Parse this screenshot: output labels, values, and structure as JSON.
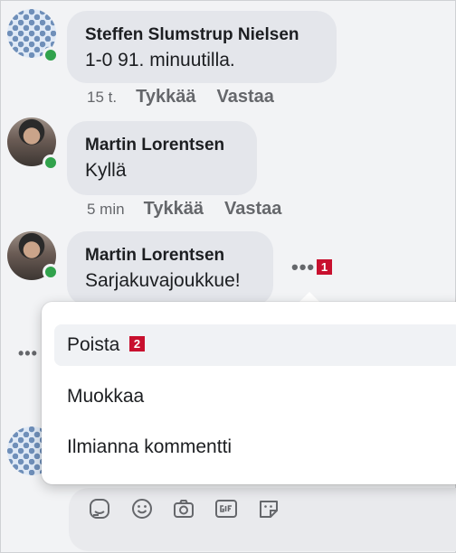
{
  "comments": [
    {
      "author": "Steffen Slumstrup Nielsen",
      "text": "1-0 91. minuutilla.",
      "time": "15 t.",
      "like": "Tykkää",
      "reply": "Vastaa",
      "avatar": "pattern-avatar"
    },
    {
      "author": "Martin Lorentsen",
      "text": "Kyllä",
      "time": "5 min",
      "like": "Tykkää",
      "reply": "Vastaa",
      "avatar": "photo-avatar"
    },
    {
      "author": "Martin Lorentsen",
      "text": "Sarjakuvajoukkue!",
      "avatar": "photo-avatar"
    }
  ],
  "more_dots": "•••",
  "badges": {
    "one": "1",
    "two": "2"
  },
  "menu": {
    "items": [
      "Poista",
      "Muokkaa",
      "Ilmianna kommentti"
    ]
  },
  "composer_icons": [
    "sticker-icon",
    "emoji-icon",
    "camera-icon",
    "gif-icon",
    "sticker-face-icon"
  ],
  "colors": {
    "online": "#31a24c",
    "badge": "#c8102e",
    "bubble": "#e4e6eb"
  }
}
